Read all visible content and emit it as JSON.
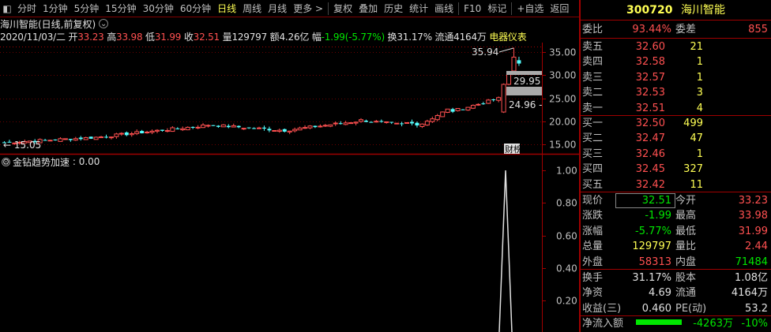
{
  "toolbar": {
    "items": [
      "分时",
      "1分钟",
      "5分钟",
      "15分钟",
      "30分钟",
      "60分钟",
      "日线",
      "周线",
      "月线",
      "更多 >",
      "复权",
      "叠加",
      "历史",
      "统计",
      "画线",
      "F10",
      "标记",
      "+自选",
      "返回"
    ],
    "active_index": 6
  },
  "title": "海川智能(日线,前复权)",
  "quote": {
    "date": "2020/11/03/二",
    "open_label": "开",
    "open": "33.23",
    "high_label": "高",
    "high": "33.98",
    "low_label": "低",
    "low": "31.99",
    "close_label": "收",
    "close": "32.51",
    "vol_label": "量",
    "vol": "129797",
    "amt_label": "额",
    "amt": "4.26亿",
    "chg_label": "幅",
    "chg": "-1.99(-5.77%)",
    "turn_label": "换",
    "turn": "31.17%",
    "float_label": "流通",
    "float": "4164万",
    "sector": "电器仪表"
  },
  "indicator": {
    "name": "金钻趋势加速",
    "value": "0.00"
  },
  "price_axis": [
    "35.00",
    "30.00",
    "25.00",
    "20.00",
    "15.00"
  ],
  "ind_axis": [
    "1.00",
    "0.80",
    "0.60",
    "0.40",
    "0.20"
  ],
  "annotations": {
    "high_mark": "35.94",
    "low_mark": "15.05",
    "level1": "29.95",
    "level2": "24.96",
    "badge": "财榜"
  },
  "panel": {
    "code": "300720",
    "name": "海川智能",
    "weibi_label": "委比",
    "weibi": "93.44%",
    "weicha_label": "委差",
    "weicha": "855",
    "asks": [
      {
        "label": "卖五",
        "price": "32.60",
        "vol": "21"
      },
      {
        "label": "卖四",
        "price": "32.58",
        "vol": "1"
      },
      {
        "label": "卖三",
        "price": "32.57",
        "vol": "1"
      },
      {
        "label": "卖二",
        "price": "32.53",
        "vol": "3"
      },
      {
        "label": "卖一",
        "price": "32.51",
        "vol": "4"
      }
    ],
    "bids": [
      {
        "label": "买一",
        "price": "32.50",
        "vol": "499"
      },
      {
        "label": "买二",
        "price": "32.47",
        "vol": "47"
      },
      {
        "label": "买三",
        "price": "32.46",
        "vol": "1"
      },
      {
        "label": "买四",
        "price": "32.45",
        "vol": "327"
      },
      {
        "label": "买五",
        "price": "32.42",
        "vol": "11"
      }
    ],
    "stats1": [
      {
        "l": "现价",
        "lv": "32.51",
        "r": "今开",
        "rv": "33.23"
      },
      {
        "l": "涨跌",
        "lv": "-1.99",
        "r": "最高",
        "rv": "33.98"
      },
      {
        "l": "涨幅",
        "lv": "-5.77%",
        "r": "最低",
        "rv": "31.99"
      },
      {
        "l": "总量",
        "lv": "129797",
        "r": "量比",
        "rv": "2.44"
      },
      {
        "l": "外盘",
        "lv": "58313",
        "r": "内盘",
        "rv": "71484"
      }
    ],
    "stats2": [
      {
        "l": "换手",
        "lv": "31.17%",
        "r": "股本",
        "rv": "1.08亿"
      },
      {
        "l": "净资",
        "lv": "4.69",
        "r": "流通",
        "rv": "4164万"
      },
      {
        "l": "收益(三)",
        "lv": "0.460",
        "r": "PE(动)",
        "rv": "53.2"
      }
    ],
    "flow_label": "净流入额",
    "flow_value": "-4263万",
    "flow_pct": "-10%"
  },
  "colors": {
    "up": "#ff5050",
    "down": "#54ffff",
    "accent": "#ffff54",
    "divider": "#a00000"
  }
}
